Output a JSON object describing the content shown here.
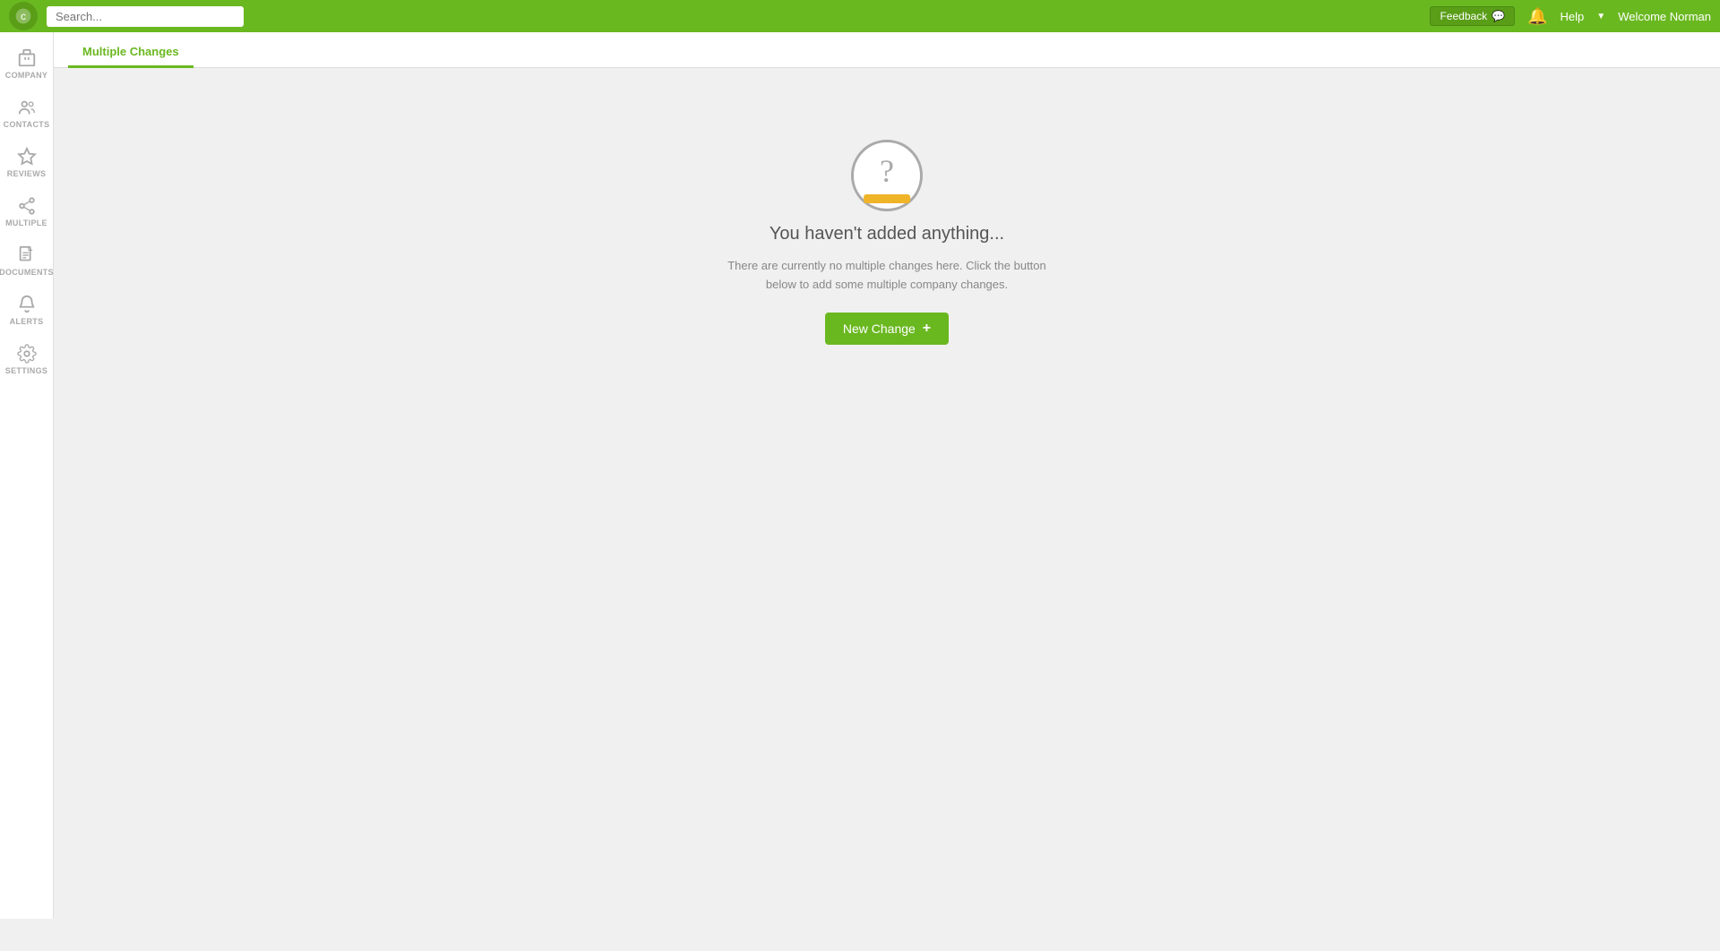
{
  "topbar": {
    "search_placeholder": "Search...",
    "feedback_label": "Feedback",
    "help_label": "Help",
    "welcome_label": "Welcome Norman"
  },
  "sidebar": {
    "items": [
      {
        "id": "company",
        "label": "COMPANY",
        "icon": "building"
      },
      {
        "id": "contacts",
        "label": "CONTACTS",
        "icon": "people"
      },
      {
        "id": "reviews",
        "label": "REVIEWS",
        "icon": "star"
      },
      {
        "id": "multiple",
        "label": "MULTIPLE",
        "icon": "share"
      },
      {
        "id": "documents",
        "label": "DOCUMENTS",
        "icon": "document"
      },
      {
        "id": "alerts",
        "label": "ALERTS",
        "icon": "bell"
      },
      {
        "id": "settings",
        "label": "SETTINGS",
        "icon": "gear"
      }
    ]
  },
  "tab": {
    "label": "Multiple Changes"
  },
  "empty_state": {
    "title": "You haven't added anything...",
    "subtitle": "There are currently no multiple changes here. Click the button below to add some multiple company changes.",
    "button_label": "New Change"
  }
}
